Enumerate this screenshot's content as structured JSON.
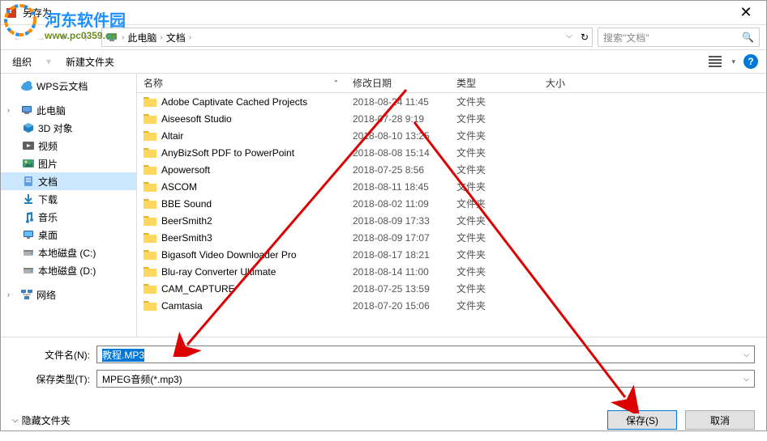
{
  "window": {
    "title": "另存为"
  },
  "watermark": {
    "text": "河东软件园",
    "url": "www.pc0359.cn"
  },
  "breadcrumb": {
    "location1": "此电脑",
    "location2": "文档"
  },
  "search": {
    "placeholder": "搜索\"文档\""
  },
  "toolbar": {
    "organize": "组织",
    "new_folder": "新建文件夹"
  },
  "sidebar": {
    "items": [
      {
        "label": "WPS云文档",
        "icon": "cloud",
        "indent": 0
      },
      {
        "label": "此电脑",
        "icon": "pc",
        "indent": 0,
        "expandable": true
      },
      {
        "label": "3D 对象",
        "icon": "3d",
        "indent": 1
      },
      {
        "label": "视频",
        "icon": "video",
        "indent": 1
      },
      {
        "label": "图片",
        "icon": "image",
        "indent": 1
      },
      {
        "label": "文档",
        "icon": "document",
        "indent": 1,
        "selected": true
      },
      {
        "label": "下载",
        "icon": "download",
        "indent": 1
      },
      {
        "label": "音乐",
        "icon": "music",
        "indent": 1
      },
      {
        "label": "桌面",
        "icon": "desktop",
        "indent": 1
      },
      {
        "label": "本地磁盘 (C:)",
        "icon": "disk",
        "indent": 1
      },
      {
        "label": "本地磁盘 (D:)",
        "icon": "disk",
        "indent": 1
      },
      {
        "label": "网络",
        "icon": "network",
        "indent": 0,
        "expandable": true
      }
    ]
  },
  "columns": {
    "name": "名称",
    "date": "修改日期",
    "type": "类型",
    "size": "大小"
  },
  "files": [
    {
      "name": "Adobe Captivate Cached Projects",
      "date": "2018-08-24 11:45",
      "type": "文件夹"
    },
    {
      "name": "Aiseesoft Studio",
      "date": "2018-07-28 9:19",
      "type": "文件夹"
    },
    {
      "name": "Altair",
      "date": "2018-08-10 13:25",
      "type": "文件夹"
    },
    {
      "name": "AnyBizSoft PDF to PowerPoint",
      "date": "2018-08-08 15:14",
      "type": "文件夹"
    },
    {
      "name": "Apowersoft",
      "date": "2018-07-25 8:56",
      "type": "文件夹"
    },
    {
      "name": "ASCOM",
      "date": "2018-08-11 18:45",
      "type": "文件夹"
    },
    {
      "name": "BBE Sound",
      "date": "2018-08-02 11:09",
      "type": "文件夹"
    },
    {
      "name": "BeerSmith2",
      "date": "2018-08-09 17:33",
      "type": "文件夹"
    },
    {
      "name": "BeerSmith3",
      "date": "2018-08-09 17:07",
      "type": "文件夹"
    },
    {
      "name": "Bigasoft Video Downloader Pro",
      "date": "2018-08-17 18:21",
      "type": "文件夹"
    },
    {
      "name": "Blu-ray Converter Ultimate",
      "date": "2018-08-14 11:00",
      "type": "文件夹"
    },
    {
      "name": "CAM_CAPTURE",
      "date": "2018-07-25 13:59",
      "type": "文件夹"
    },
    {
      "name": "Camtasia",
      "date": "2018-07-20 15:06",
      "type": "文件夹"
    }
  ],
  "form": {
    "filename_label": "文件名(N):",
    "filename_value": "教程.MP3",
    "filetype_label": "保存类型(T):",
    "filetype_value": "MPEG音频(*.mp3)"
  },
  "footer": {
    "hide_folders": "隐藏文件夹",
    "save": "保存(S)",
    "cancel": "取消"
  }
}
